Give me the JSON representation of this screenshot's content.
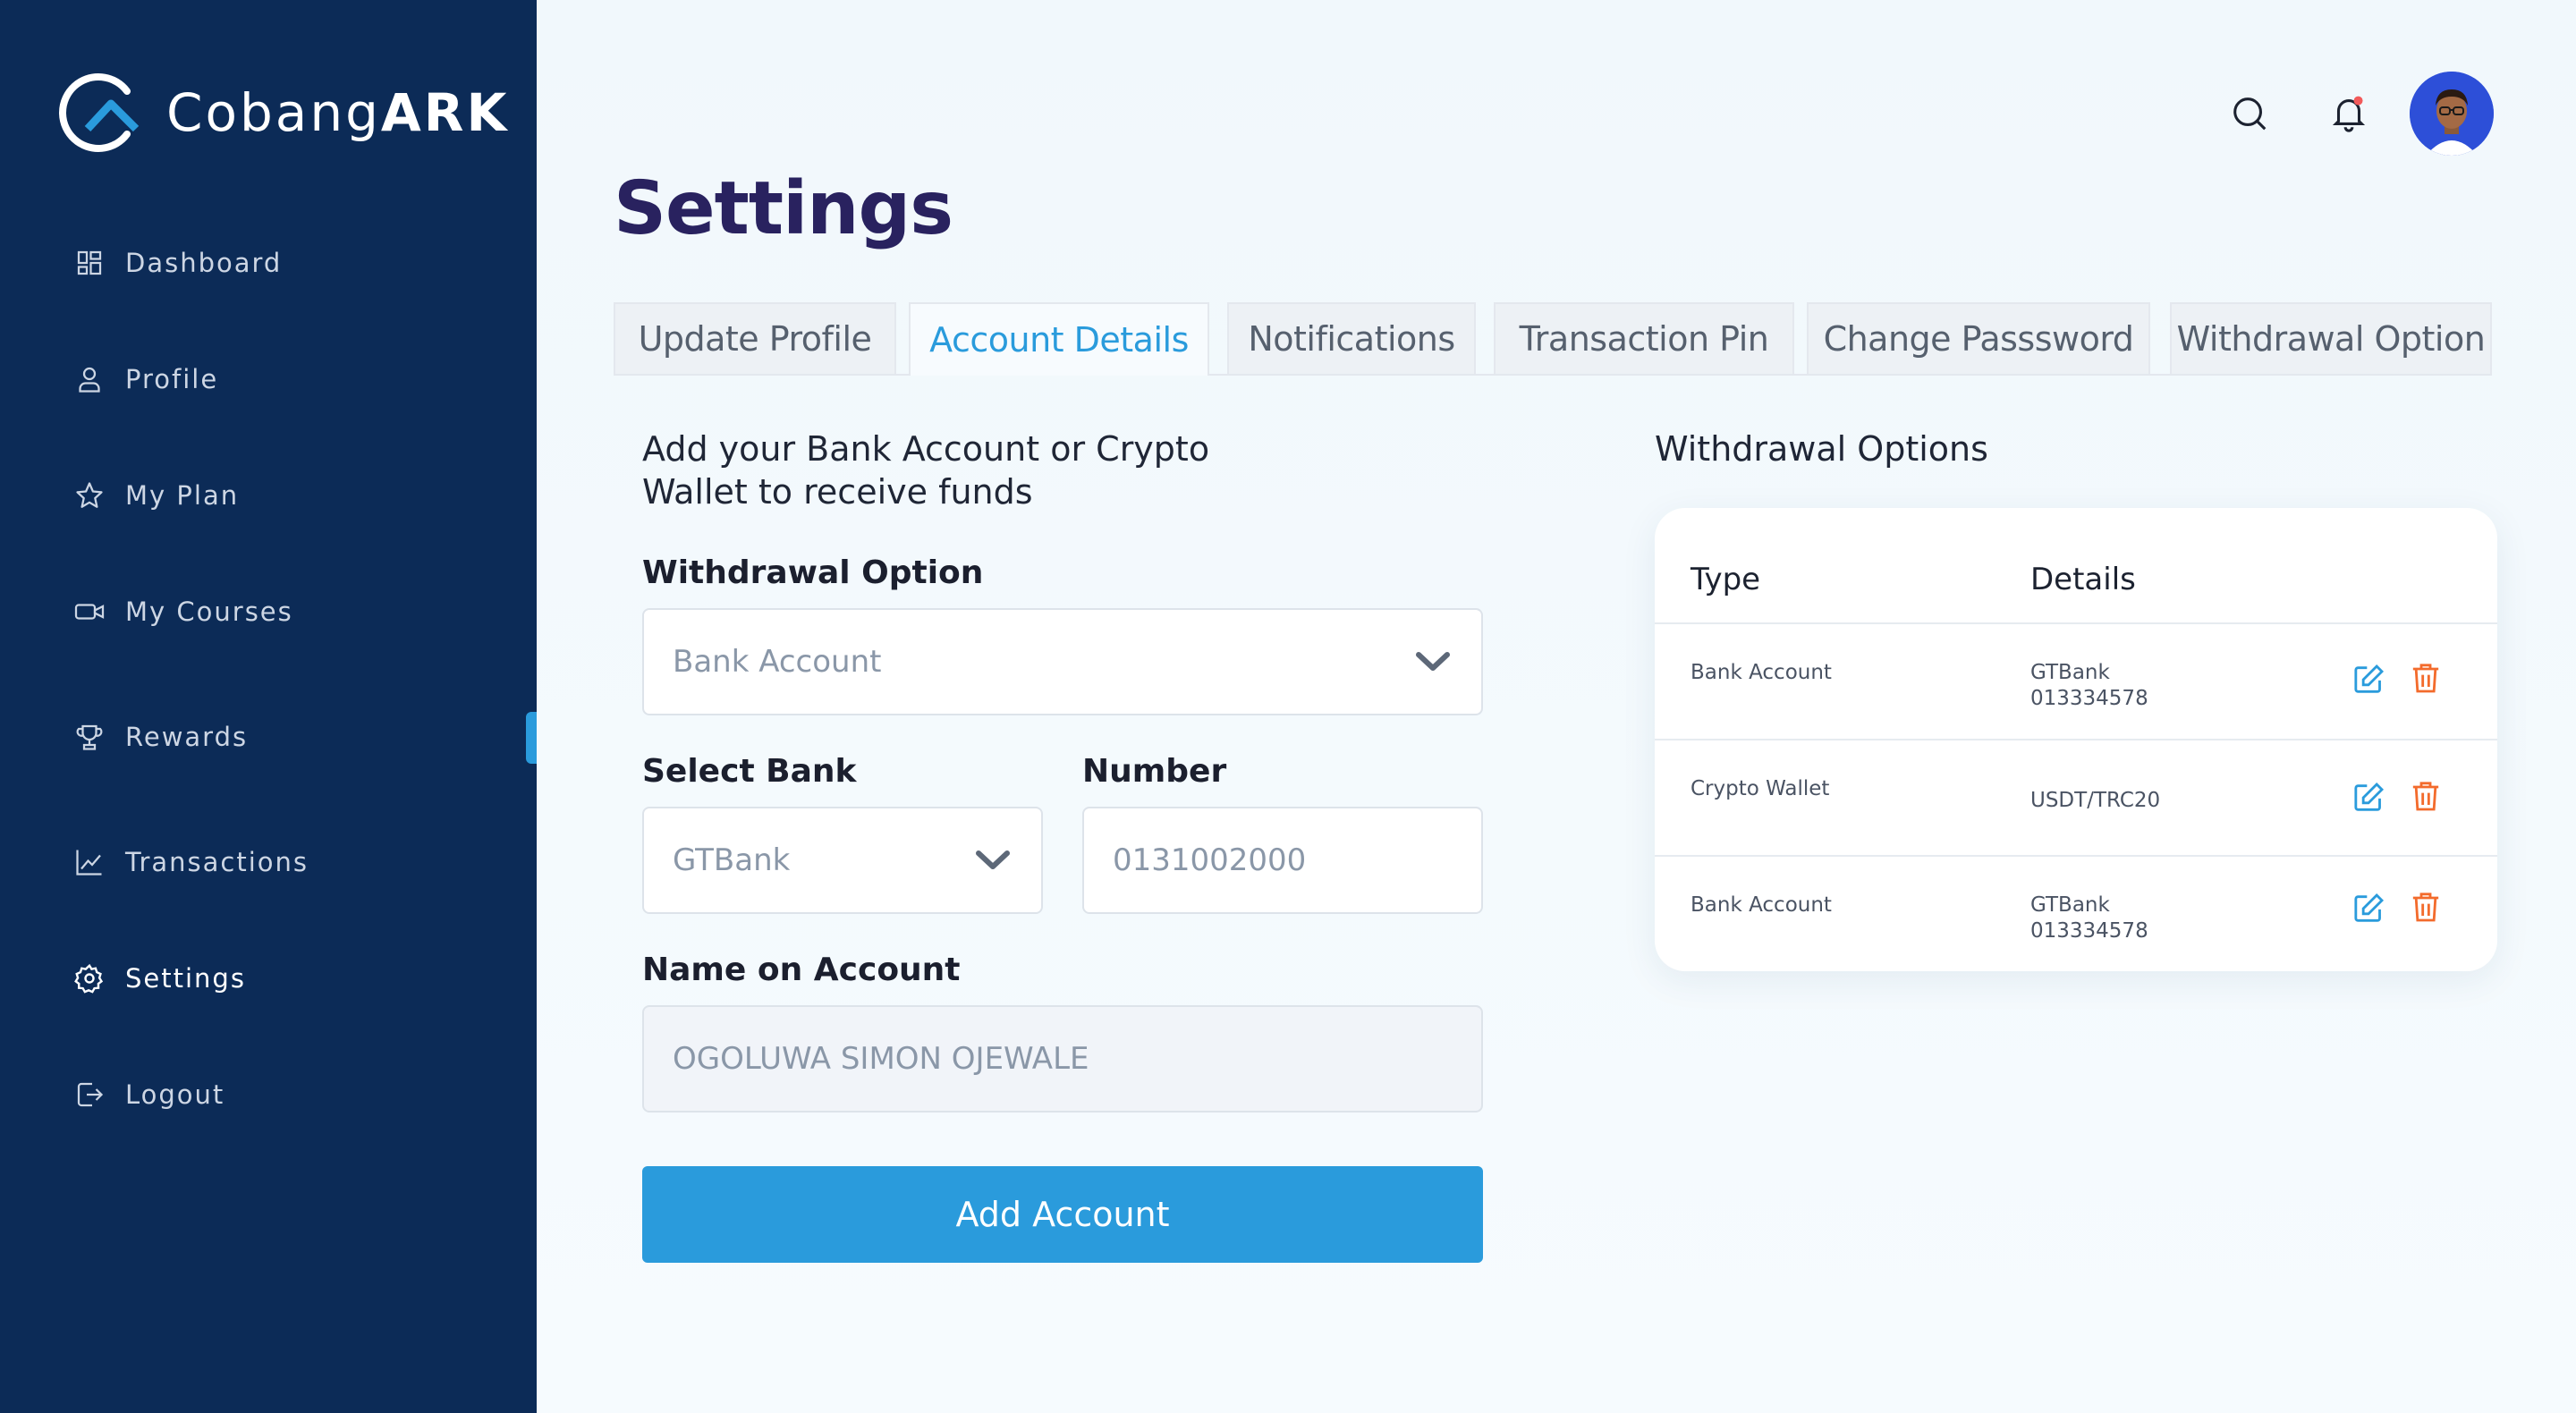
{
  "brand": {
    "name_light": "Cobang",
    "name_bold": "ARK"
  },
  "sidebar": {
    "items": [
      {
        "label": "Dashboard",
        "icon": "dashboard-icon"
      },
      {
        "label": "Profile",
        "icon": "user-icon"
      },
      {
        "label": "My Plan",
        "icon": "star-icon"
      },
      {
        "label": "My Courses",
        "icon": "video-icon"
      },
      {
        "label": "Rewards",
        "icon": "trophy-icon"
      },
      {
        "label": "Transactions",
        "icon": "chart-icon"
      },
      {
        "label": "Settings",
        "icon": "gear-icon"
      },
      {
        "label": "Logout",
        "icon": "logout-icon"
      }
    ],
    "active": "Settings"
  },
  "page": {
    "title": "Settings"
  },
  "tabs": [
    {
      "label": "Update Profile"
    },
    {
      "label": "Account Details"
    },
    {
      "label": "Notifications"
    },
    {
      "label": "Transaction Pin"
    },
    {
      "label": "Change Passsword"
    },
    {
      "label": "Withdrawal Option"
    }
  ],
  "active_tab": "Account Details",
  "form": {
    "intro_line1": "Add your Bank Account or Crypto",
    "intro_line2": "Wallet to receive funds",
    "withdrawal_label": "Withdrawal Option",
    "withdrawal_value": "Bank Account",
    "bank_label": "Select Bank",
    "bank_value": "GTBank",
    "number_label": "Number",
    "number_value": "0131002000",
    "name_label": "Name on Account",
    "name_value": "OGOLUWA SIMON OJEWALE",
    "submit_label": "Add Account"
  },
  "options": {
    "heading": "Withdrawal Options",
    "columns": [
      "Type",
      "Details"
    ],
    "rows": [
      {
        "type": "Bank Account",
        "details_line1": "GTBank",
        "details_line2": "013334578"
      },
      {
        "type": "Crypto Wallet",
        "details_line1": "",
        "details_line2": "USDT/TRC20"
      },
      {
        "type": "Bank Account",
        "details_line1": "GTBank",
        "details_line2": "013334578"
      }
    ]
  },
  "colors": {
    "sidebar": "#0c2b57",
    "accent": "#2a9bdc",
    "title": "#29225f",
    "delete": "#f36b2c",
    "notification_dot": "#f25a5a"
  }
}
